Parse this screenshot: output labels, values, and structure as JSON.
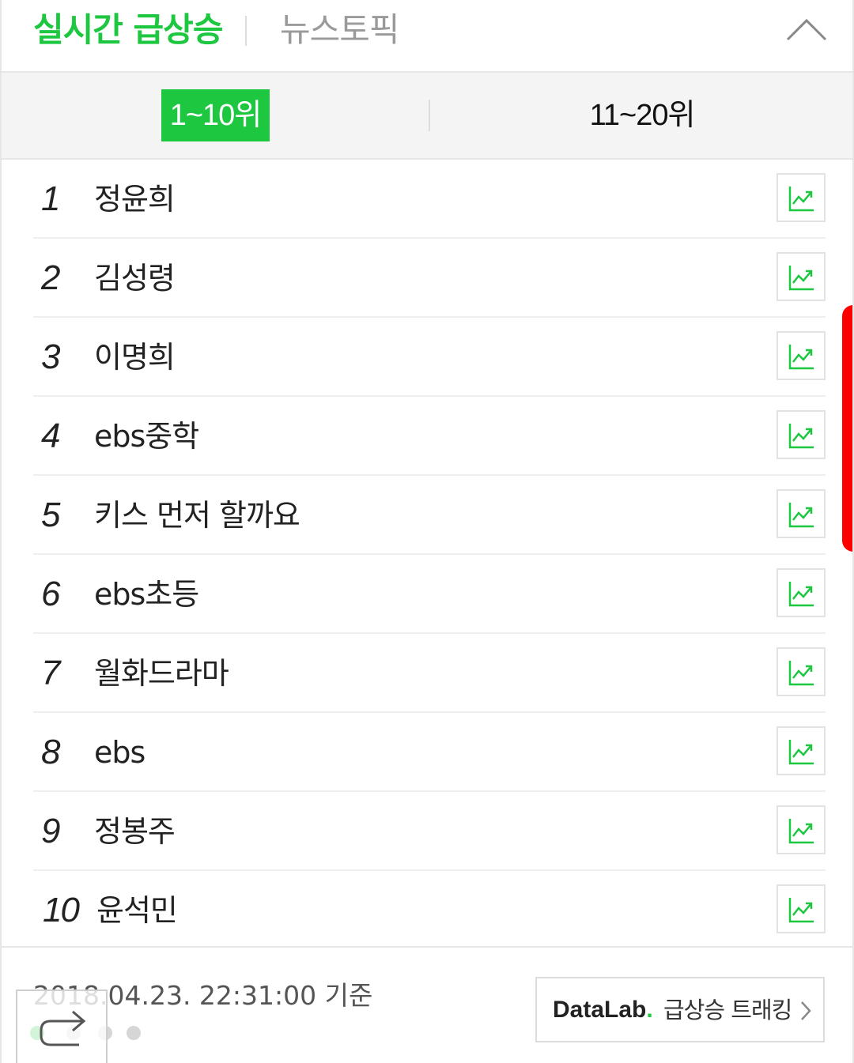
{
  "header": {
    "tab_realtime": "실시간 급상승",
    "tab_news": "뉴스토픽",
    "collapse_icon": "chevron-up-icon"
  },
  "range": {
    "active": "1~10위",
    "other": "11~20위"
  },
  "ranking": [
    {
      "rank": "1",
      "keyword": "정윤희"
    },
    {
      "rank": "2",
      "keyword": "김성령"
    },
    {
      "rank": "3",
      "keyword": "이명희"
    },
    {
      "rank": "4",
      "keyword": "ebs중학"
    },
    {
      "rank": "5",
      "keyword": "키스 먼저 할까요"
    },
    {
      "rank": "6",
      "keyword": "ebs초등"
    },
    {
      "rank": "7",
      "keyword": "월화드라마"
    },
    {
      "rank": "8",
      "keyword": "ebs"
    },
    {
      "rank": "9",
      "keyword": "정봉주"
    },
    {
      "rank": "10",
      "keyword": "윤석민"
    }
  ],
  "trend_icon": "trend-chart-icon",
  "footer": {
    "timestamp": "2018.04.23. 22:31:00 기준",
    "datalab_brand": "DataLab",
    "datalab_dot": ".",
    "datalab_label": "급상승 트래킹",
    "datalab_icon": "chevron-right-icon"
  },
  "overlay": {
    "share_icon": "share-arrow-icon"
  },
  "colors": {
    "accent": "#1ec740",
    "scroll_indicator": "#ff0000"
  }
}
